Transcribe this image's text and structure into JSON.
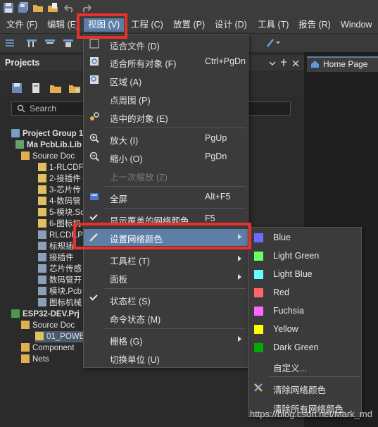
{
  "menubar": {
    "items": [
      {
        "label": "文件 (F)"
      },
      {
        "label": "编辑 (E)"
      },
      {
        "label": "视图 (V)"
      },
      {
        "label": "工程 (C)"
      },
      {
        "label": "放置 (P)"
      },
      {
        "label": "设计 (D)"
      },
      {
        "label": "工具 (T)"
      },
      {
        "label": "报告 (R)"
      },
      {
        "label": "Window"
      }
    ]
  },
  "projects_panel": {
    "title": "Projects",
    "search_placeholder": "Search",
    "tree": [
      {
        "label": "Project Group 1."
      },
      {
        "label": "Ma PcbLib.Lib"
      },
      {
        "label": "Source Doc"
      },
      {
        "label": "1-RLCDF"
      },
      {
        "label": "2-接插件"
      },
      {
        "label": "3-芯片传"
      },
      {
        "label": "4-数码管"
      },
      {
        "label": "5-模块.Sc"
      },
      {
        "label": "6-图标机"
      },
      {
        "label": "RLCDF.Pc"
      },
      {
        "label": "标规插"
      },
      {
        "label": "接插件"
      },
      {
        "label": "芯片传感"
      },
      {
        "label": "数码管开"
      },
      {
        "label": "模块.Pcb"
      },
      {
        "label": "图标机械"
      },
      {
        "label": "ESP32-DEV.Prj"
      },
      {
        "label": "Source Doc"
      },
      {
        "label": "01_POWE"
      },
      {
        "label": "Component"
      },
      {
        "label": "Nets"
      }
    ]
  },
  "doc_tab": {
    "label": "Home Page"
  },
  "view_menu": {
    "items": [
      {
        "label": "适合文件 (D)",
        "shortcut": ""
      },
      {
        "label": "适合所有对象 (F)",
        "shortcut": "Ctrl+PgDn"
      },
      {
        "label": "区域 (A)",
        "shortcut": ""
      },
      {
        "label": "点周围 (P)",
        "shortcut": ""
      },
      {
        "label": "选中的对象 (E)",
        "shortcut": ""
      },
      {
        "label": "放大 (I)",
        "shortcut": "PgUp"
      },
      {
        "label": "缩小 (O)",
        "shortcut": "PgDn"
      },
      {
        "label": "上一次缩放 (Z)",
        "shortcut": ""
      },
      {
        "label": "全屏",
        "shortcut": "Alt+F5"
      },
      {
        "label": "显示覆盖的网络颜色",
        "shortcut": "F5"
      },
      {
        "label": "设置网络颜色",
        "shortcut": ""
      },
      {
        "label": "工具栏 (T)",
        "shortcut": ""
      },
      {
        "label": "面板",
        "shortcut": ""
      },
      {
        "label": "状态栏 (S)",
        "shortcut": ""
      },
      {
        "label": "命令状态 (M)",
        "shortcut": ""
      },
      {
        "label": "栅格 (G)",
        "shortcut": ""
      },
      {
        "label": "切换单位 (U)",
        "shortcut": ""
      }
    ]
  },
  "net_color_submenu": {
    "items": [
      {
        "label": "Blue",
        "color": "#6b6bff"
      },
      {
        "label": "Light Green",
        "color": "#66ff66"
      },
      {
        "label": "Light Blue",
        "color": "#66ffff"
      },
      {
        "label": "Red",
        "color": "#ff6666"
      },
      {
        "label": "Fuchsia",
        "color": "#ff66ff"
      },
      {
        "label": "Yellow",
        "color": "#ffff00"
      },
      {
        "label": "Dark Green",
        "color": "#00aa00"
      },
      {
        "label": "自定义..."
      },
      {
        "label": "清除网络颜色"
      },
      {
        "label": "清除所有网络颜色"
      }
    ]
  },
  "watermark": "https://blog.csdn.net/Mark_md",
  "colors": {
    "accent": "#5d7ea6",
    "annotation_red": "#e8302c"
  }
}
